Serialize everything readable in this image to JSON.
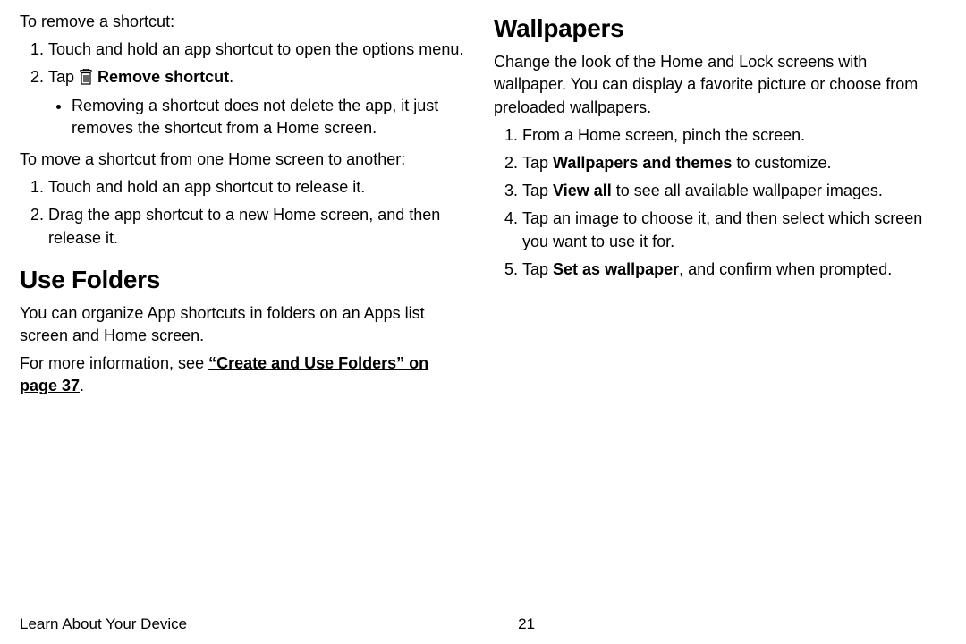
{
  "left": {
    "intro1": "To remove a shortcut:",
    "remove": {
      "step1": "Touch and hold an app shortcut to open the options menu.",
      "step2_prefix": "Tap ",
      "step2_bold": "Remove shortcut",
      "step2_suffix": ".",
      "bullet": "Removing a shortcut does not delete the app, it just removes the shortcut from a Home screen."
    },
    "intro2": "To move a shortcut from one Home screen to another:",
    "move": {
      "step1": "Touch and hold an app shortcut to release it.",
      "step2": "Drag the app shortcut to a new Home screen, and then release it."
    },
    "folders_heading": "Use Folders",
    "folders_p1": "You can organize App shortcuts in folders on an Apps list screen and Home screen.",
    "folders_p2a": "For more information, see ",
    "folders_link": "“Create and Use Folders” on page 37",
    "folders_p2b": "."
  },
  "right": {
    "heading": "Wallpapers",
    "intro": "Change the look of the Home and Lock screens with wallpaper. You can display a favorite picture or choose from preloaded wallpapers.",
    "steps": {
      "s1": "From a Home screen, pinch the screen.",
      "s2a": "Tap ",
      "s2b": "Wallpapers and themes",
      "s2c": " to customize.",
      "s3a": "Tap ",
      "s3b": "View all",
      "s3c": " to see all available wallpaper images.",
      "s4": "Tap an image to choose it, and then select which screen you want to use it for.",
      "s5a": "Tap ",
      "s5b": "Set as wallpaper",
      "s5c": ", and confirm when prompted."
    }
  },
  "footer": {
    "section": "Learn About Your Device",
    "page": "21"
  }
}
